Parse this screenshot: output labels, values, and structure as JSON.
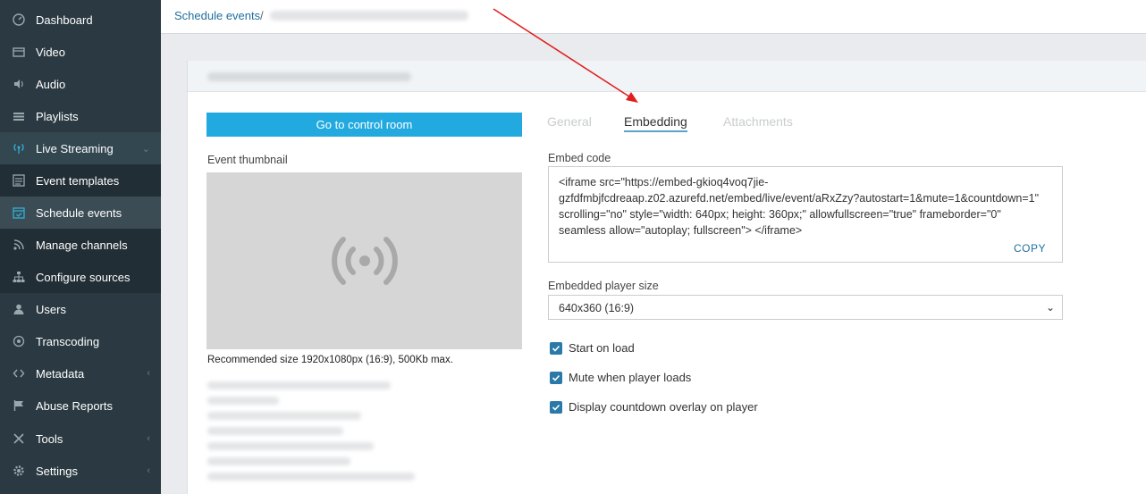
{
  "sidebar": {
    "items": [
      {
        "label": "Dashboard",
        "icon": "dashboard-icon"
      },
      {
        "label": "Video",
        "icon": "video-icon"
      },
      {
        "label": "Audio",
        "icon": "audio-icon"
      },
      {
        "label": "Playlists",
        "icon": "playlist-icon"
      },
      {
        "label": "Live Streaming",
        "icon": "broadcast-icon"
      },
      {
        "label": "Event templates",
        "icon": "template-icon"
      },
      {
        "label": "Schedule events",
        "icon": "calendar-icon"
      },
      {
        "label": "Manage channels",
        "icon": "rss-icon"
      },
      {
        "label": "Configure sources",
        "icon": "sitemap-icon"
      },
      {
        "label": "Users",
        "icon": "user-icon"
      },
      {
        "label": "Transcoding",
        "icon": "transcode-icon"
      },
      {
        "label": "Metadata",
        "icon": "code-icon"
      },
      {
        "label": "Abuse Reports",
        "icon": "flag-icon"
      },
      {
        "label": "Tools",
        "icon": "tools-icon"
      },
      {
        "label": "Settings",
        "icon": "gear-icon"
      }
    ]
  },
  "breadcrumb": {
    "link": "Schedule events",
    "sep": "/"
  },
  "left": {
    "control_button": "Go to control room",
    "thumb_label": "Event thumbnail",
    "recommended": "Recommended size 1920x1080px (16:9), 500Kb max."
  },
  "tabs": {
    "general": "General",
    "embedding": "Embedding",
    "attachments": "Attachments"
  },
  "embed": {
    "label": "Embed code",
    "code": "<iframe src=\"https://embed-gkioq4voq7jie-\ngzfdfmbjfcdreaap.z02.azurefd.net/embed/live/event/aRxZzy?autostart=1&mute=1&countdown=1\"\nscrolling=\"no\" style=\"width: 640px; height: 360px;\" allowfullscreen=\"true\" frameborder=\"0\"\nseamless  allow=\"autoplay; fullscreen\"> </iframe>",
    "copy": "COPY"
  },
  "player_size": {
    "label": "Embedded player size",
    "value": "640x360 (16:9)"
  },
  "options": {
    "start_on_load": "Start on load",
    "mute": "Mute when player loads",
    "countdown": "Display countdown overlay on player"
  },
  "colors": {
    "sidebar_bg": "#2b3a42",
    "accent": "#22aae0",
    "link": "#1f6f9f",
    "checkbox": "#2a79a8",
    "annotation_arrow": "#e02020"
  }
}
